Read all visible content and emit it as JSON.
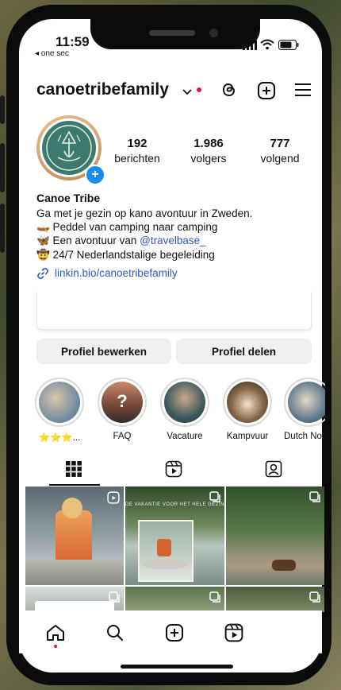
{
  "status": {
    "time": "11:59",
    "back_app": "◂ one sec"
  },
  "header": {
    "username": "canoetribefamily"
  },
  "stats": [
    {
      "value": "192",
      "label": "berichten"
    },
    {
      "value": "1.986",
      "label": "volgers"
    },
    {
      "value": "777",
      "label": "volgend"
    }
  ],
  "bio": {
    "name": "Canoe Tribe",
    "line1": "Ga met je gezin op kano avontuur in Zweden.",
    "line2": "🛶 Peddel van camping naar camping",
    "line3_prefix": "🦋 Een avontuur van ",
    "line3_mention": "@travelbase_",
    "line4": "🤠 24/7 Nederlandstalige begeleiding",
    "link": "linkin.bio/canoetribefamily"
  },
  "buttons": {
    "edit": "Profiel bewerken",
    "share": "Profiel delen"
  },
  "highlights": [
    {
      "label": "⭐⭐⭐..."
    },
    {
      "label": "FAQ"
    },
    {
      "label": "Vacature"
    },
    {
      "label": "Kampvuur"
    },
    {
      "label": "Dutch Nor"
    }
  ],
  "posts": {
    "post2_caption": "DE VAKANTIE VOOR HET HELE GEZIN"
  },
  "colors": {
    "accent": "#e4163d",
    "link": "#2f57c7",
    "brand_teal": "#3c7a6d"
  }
}
